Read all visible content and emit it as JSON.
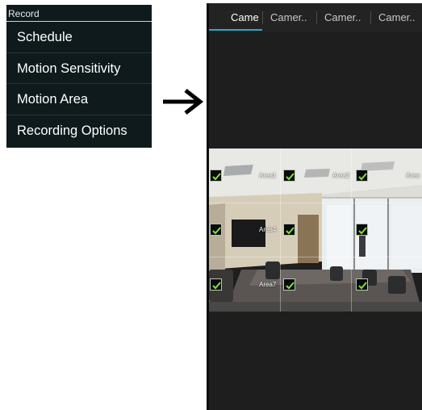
{
  "menu": {
    "header": "Record",
    "items": [
      {
        "label": "Schedule"
      },
      {
        "label": "Motion Sensitivity"
      },
      {
        "label": "Motion Area"
      },
      {
        "label": "Recording Options"
      }
    ]
  },
  "arrow_icon": "right-arrow-icon",
  "tabs": [
    {
      "label": "Came",
      "active": true
    },
    {
      "label": "Camer..",
      "active": false
    },
    {
      "label": "Camer..",
      "active": false
    },
    {
      "label": "Camer..",
      "active": false
    }
  ],
  "camera": {
    "areas": [
      {
        "label": "Area1",
        "checked": true
      },
      {
        "label": "Area2",
        "checked": true
      },
      {
        "label": "Area",
        "checked": true
      },
      {
        "label": "Area4",
        "checked": true
      },
      {
        "label": "",
        "checked": true
      },
      {
        "label": "",
        "checked": true
      },
      {
        "label": "Area7",
        "checked": true
      },
      {
        "label": "",
        "checked": true
      },
      {
        "label": "",
        "checked": true
      }
    ]
  },
  "colors": {
    "menu_bg": "#0e1a1c",
    "phone_bg": "#1e1e1e",
    "tab_indicator": "#33a6cc",
    "check_green": "#7ee23a"
  }
}
